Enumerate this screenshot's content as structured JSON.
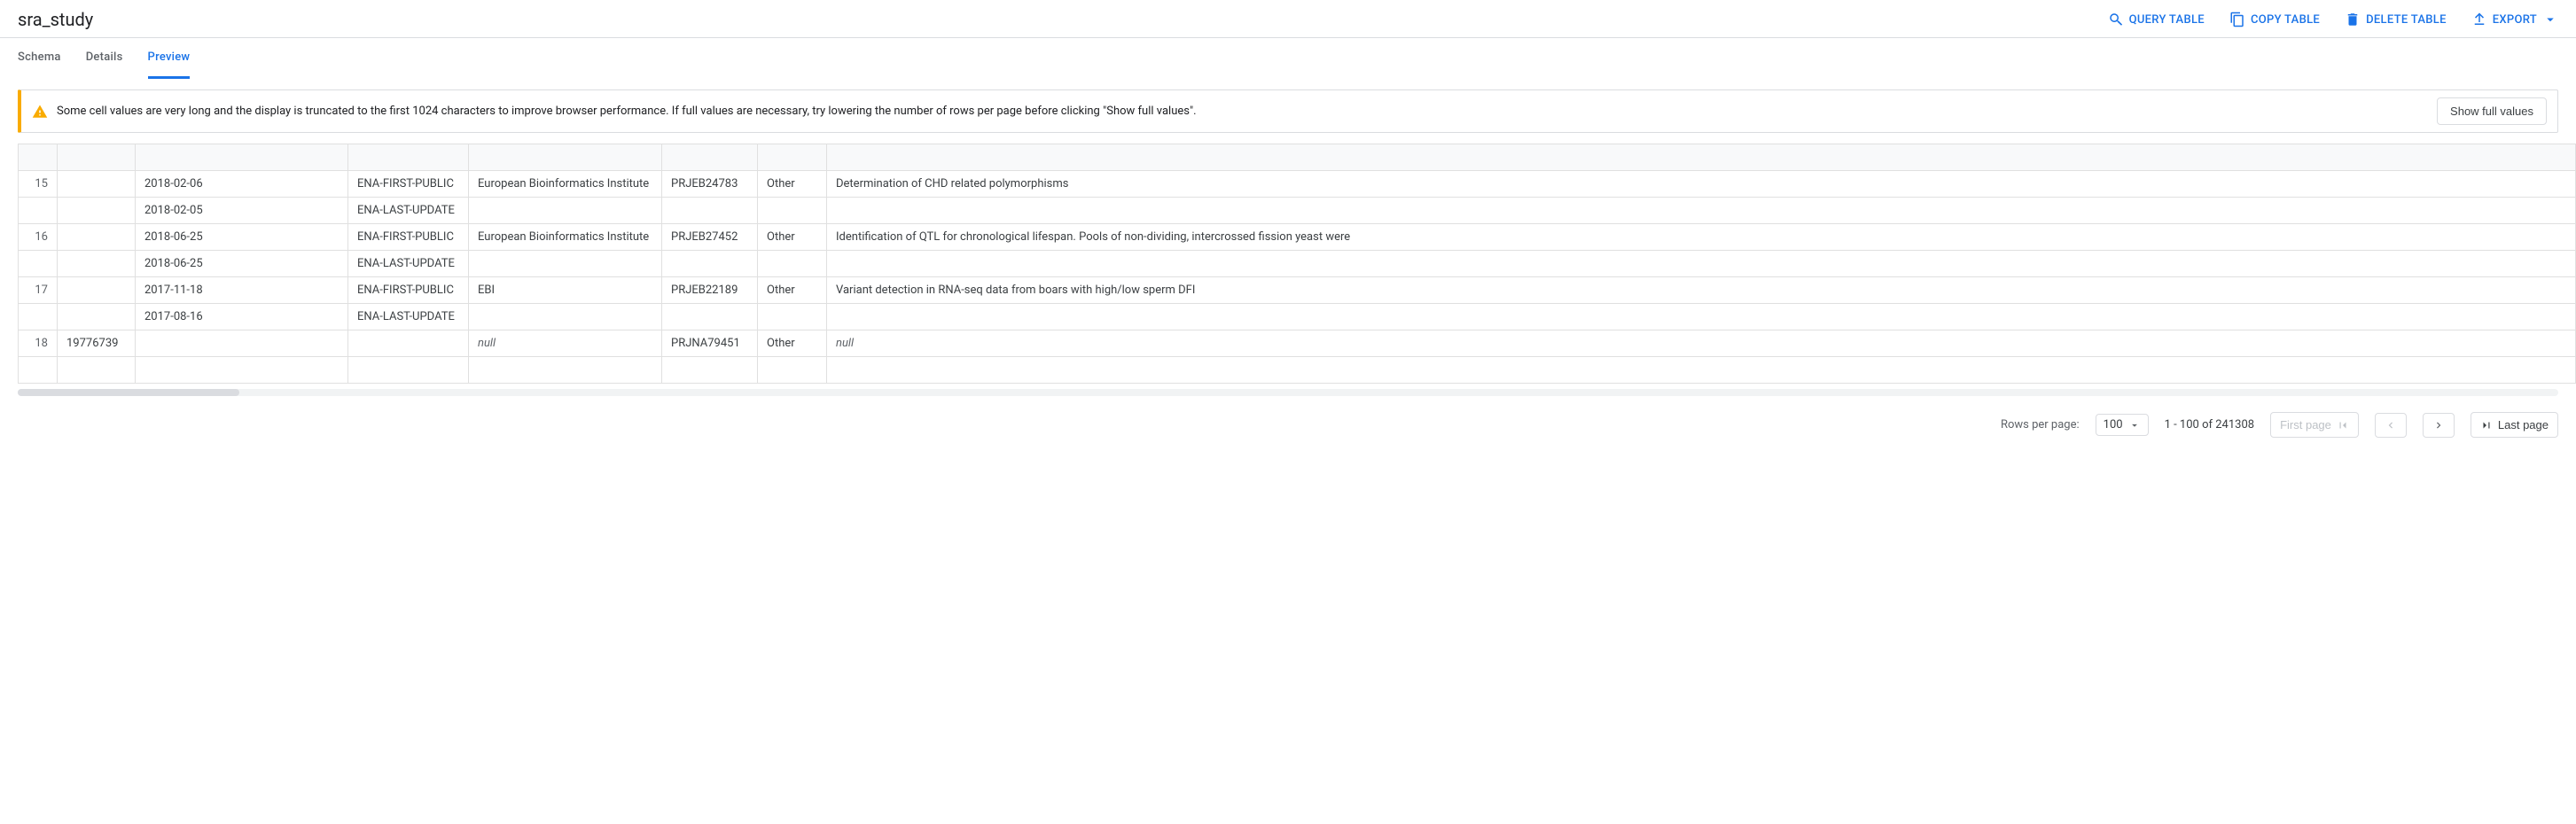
{
  "header": {
    "title": "sra_study",
    "actions": {
      "query": "Query Table",
      "copy": "Copy Table",
      "delete": "Delete Table",
      "export": "Export"
    }
  },
  "tabs": {
    "schema": "Schema",
    "details": "Details",
    "preview": "Preview"
  },
  "alert": {
    "text": "Some cell values are very long and the display is truncated to the first 1024 characters to improve browser performance. If full values are necessary, try lowering the number of rows per page before clicking \"Show full values\".",
    "button": "Show full values"
  },
  "table": {
    "rows": [
      {
        "n": "15",
        "c2": "",
        "date": "2018-02-06",
        "tag": "ENA-FIRST-PUBLIC",
        "inst": "European Bioinformatics Institute",
        "acc": "PRJEB24783",
        "kind": "Other",
        "desc": "Determination of CHD related polymorphisms"
      },
      {
        "n": "",
        "c2": "",
        "date": "2018-02-05",
        "tag": "ENA-LAST-UPDATE",
        "inst": "",
        "acc": "",
        "kind": "",
        "desc": ""
      },
      {
        "n": "16",
        "c2": "",
        "date": "2018-06-25",
        "tag": "ENA-FIRST-PUBLIC",
        "inst": "European Bioinformatics Institute",
        "acc": "PRJEB27452",
        "kind": "Other",
        "desc": "Identification of QTL for chronological lifespan. Pools of non-dividing, intercrossed fission yeast were"
      },
      {
        "n": "",
        "c2": "",
        "date": "2018-06-25",
        "tag": "ENA-LAST-UPDATE",
        "inst": "",
        "acc": "",
        "kind": "",
        "desc": ""
      },
      {
        "n": "17",
        "c2": "",
        "date": "2017-11-18",
        "tag": "ENA-FIRST-PUBLIC",
        "inst": "EBI",
        "acc": "PRJEB22189",
        "kind": "Other",
        "desc": "Variant detection in RNA-seq data from boars with high/low sperm DFI"
      },
      {
        "n": "",
        "c2": "",
        "date": "2017-08-16",
        "tag": "ENA-LAST-UPDATE",
        "inst": "",
        "acc": "",
        "kind": "",
        "desc": ""
      },
      {
        "n": "18",
        "c2": "19776739",
        "date": "",
        "tag": "",
        "inst": "null",
        "acc": "PRJNA79451",
        "kind": "Other",
        "desc": "null"
      },
      {
        "n": "",
        "c2": "",
        "date": "",
        "tag": "",
        "inst": "",
        "acc": "",
        "kind": "",
        "desc": ""
      }
    ]
  },
  "pager": {
    "rpp_label": "Rows per page:",
    "rpp_value": "100",
    "range": "1 - 100 of 241308",
    "first": "First page",
    "last": "Last page"
  }
}
